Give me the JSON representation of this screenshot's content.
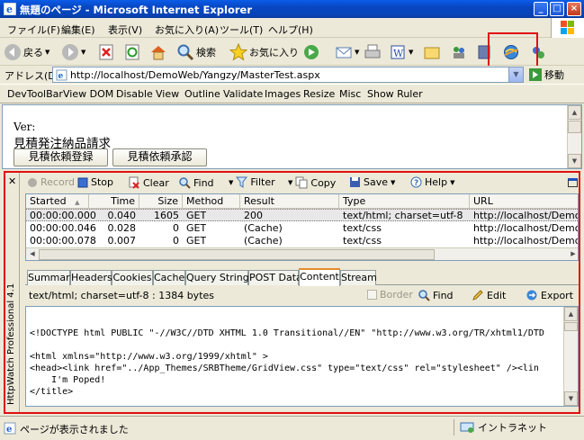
{
  "window": {
    "title": "無題のページ - Microsoft Internet Explorer"
  },
  "menu": [
    "ファイル(F)",
    "編集(E)",
    "表示(V)",
    "お気に入り(A)",
    "ツール(T)",
    "ヘルプ(H)"
  ],
  "toolbar": {
    "back": "戻る",
    "search": "検索",
    "favorites": "お気に入り"
  },
  "address": {
    "label": "アドレス(D)",
    "url": "http://localhost/DemoWeb/Yangzy/MasterTest.aspx",
    "go": "移動"
  },
  "devtoolbar": [
    "DevToolBar",
    "View DOM",
    "Disable",
    "View",
    "Outline",
    "Validate",
    "Images",
    "Resize",
    "Misc",
    "Show Ruler"
  ],
  "page": {
    "ver_label": "Ver:",
    "heading": "見積発注納品請求",
    "buttons": [
      "見積依頼登録",
      "見積依頼承認"
    ]
  },
  "httpwatch": {
    "title": "HttpWatch Professional 4.1",
    "toolbar": {
      "record": "Record",
      "stop": "Stop",
      "clear": "Clear",
      "find": "Find",
      "filter": "Filter",
      "copy": "Copy",
      "save": "Save",
      "help": "Help"
    },
    "columns": [
      "Started",
      "Time",
      "Size",
      "Method",
      "Result",
      "Type",
      "URL"
    ],
    "rows": [
      {
        "started": "00:00:00.000",
        "time": "0.040",
        "size": "1605",
        "method": "GET",
        "result": "200",
        "type": "text/html; charset=utf-8",
        "url": "http://localhost/DemoWeb/"
      },
      {
        "started": "00:00:00.046",
        "time": "0.028",
        "size": "0",
        "method": "GET",
        "result": "(Cache)",
        "type": "text/css",
        "url": "http://localhost/DemoWeb/"
      },
      {
        "started": "00:00:00.078",
        "time": "0.007",
        "size": "0",
        "method": "GET",
        "result": "(Cache)",
        "type": "text/css",
        "url": "http://localhost/DemoWeb/"
      }
    ],
    "tabs": [
      "Summary",
      "Headers",
      "Cookies",
      "Cache",
      "Query String",
      "POST Data",
      "Content",
      "Stream"
    ],
    "active_tab": "Content",
    "content_info": "text/html; charset=utf-8 : 1384 bytes",
    "content_tools": {
      "border": "Border",
      "find": "Find",
      "edit": "Edit",
      "export": "Export"
    },
    "code_lines": [
      "<!DOCTYPE html PUBLIC \"-//W3C//DTD XHTML 1.0 Transitional//EN\" \"http://www.w3.org/TR/xhtml1/DTD",
      "<html xmlns=\"http://www.w3.org/1999/xhtml\" >",
      "<head><link href=\"../App_Themes/SRBTheme/GridView.css\" type=\"text/css\" rel=\"stylesheet\" /><lin",
      "    I'm Poped!",
      "</title>"
    ]
  },
  "status": {
    "message": "ページが表示されました",
    "zone": "イントラネット"
  }
}
